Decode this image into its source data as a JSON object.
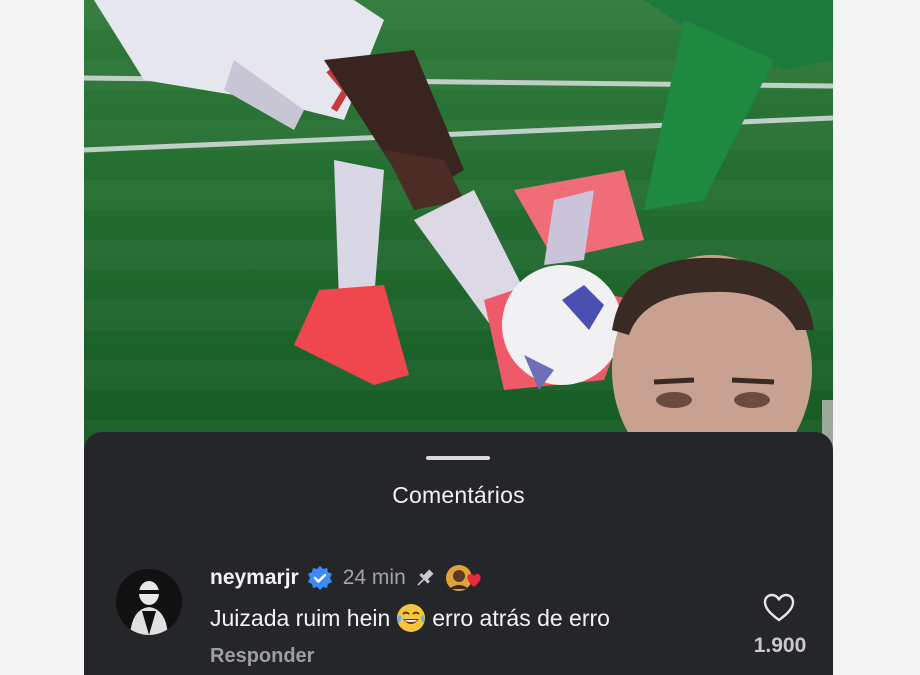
{
  "sheet": {
    "title": "Comentários"
  },
  "comment": {
    "username": "neymarjr",
    "verified": true,
    "time": "24 min",
    "pinned": true,
    "creator_reacted": true,
    "text_before": "Juizada ruim hein",
    "text_emoji": "face-with-tears-of-joy-icon",
    "text_after": "erro atrás de erro",
    "reply_label": "Responder",
    "like_count": "1.900"
  },
  "colors": {
    "sheet_background": "#25262a",
    "verified_badge": "#3a8cf5",
    "heart_reaction": "#e8283c",
    "pitch_green": "#1b6a2c"
  }
}
